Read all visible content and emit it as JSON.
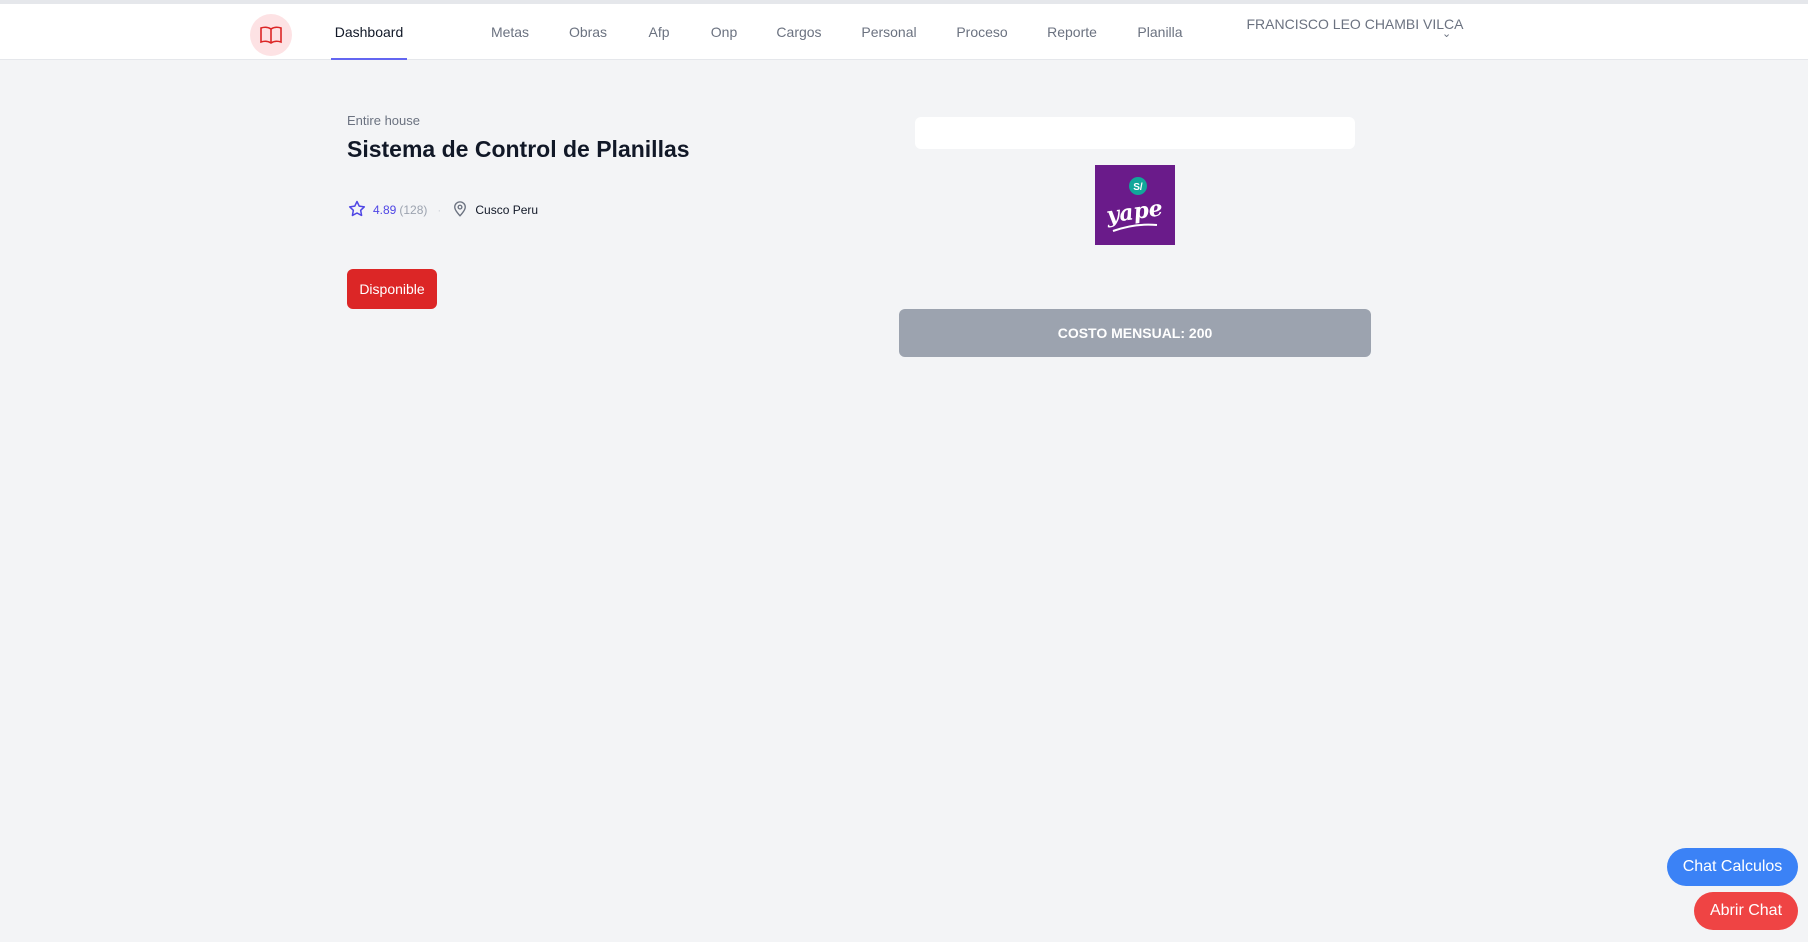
{
  "nav": {
    "items": [
      {
        "label": "Dashboard",
        "active": true
      },
      {
        "label": "Metas"
      },
      {
        "label": "Obras"
      },
      {
        "label": "Afp"
      },
      {
        "label": "Onp"
      },
      {
        "label": "Cargos"
      },
      {
        "label": "Personal"
      },
      {
        "label": "Proceso"
      },
      {
        "label": "Reporte"
      },
      {
        "label": "Planilla"
      }
    ],
    "user_name": "FRANCISCO LEO CHAMBI VILCA"
  },
  "listing": {
    "subtitle": "Entire house",
    "title": "Sistema de Control de Planillas",
    "rating": "4.89",
    "reviews": "(128)",
    "location": "Cusco Peru",
    "status_label": "Disponible"
  },
  "payment": {
    "input_value": "",
    "logo_text": "yape",
    "logo_badge": "S/",
    "cost_label": "COSTO MENSUAL: 200"
  },
  "floating": {
    "chat_calc_label": "Chat Calculos",
    "chat_open_label": "Abrir Chat"
  },
  "colors": {
    "accent": "#6366f1",
    "danger": "#dc2626",
    "yape_purple": "#6a1b8a",
    "chat_blue": "#3b82f6",
    "chat_red": "#ef4444"
  }
}
